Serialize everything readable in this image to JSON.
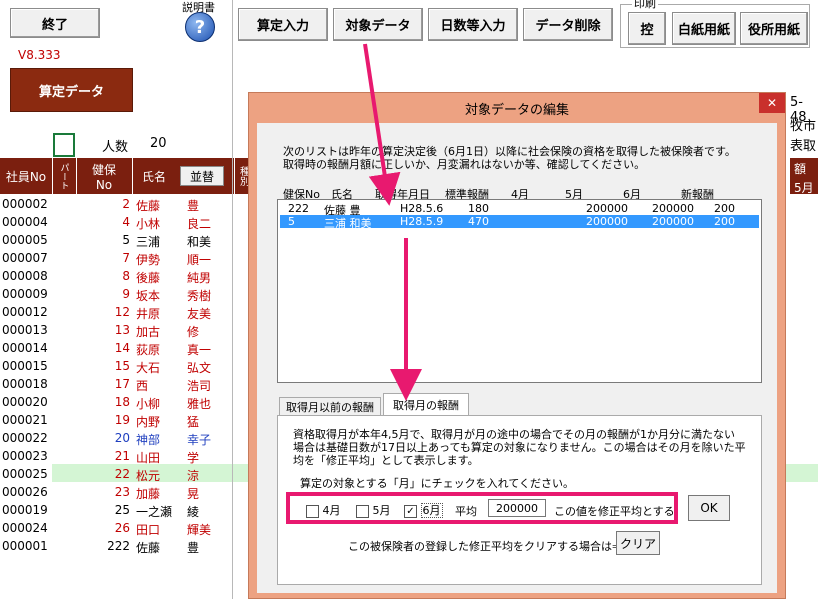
{
  "toolbar": {
    "end_label": "終了",
    "help_label": "説明書",
    "version": "V8.333",
    "santei_data_label": "算定データ",
    "santei_input_label": "算定入力",
    "target_data_label": "対象データ",
    "days_input_label": "日数等入力",
    "delete_label": "データ削除",
    "print_group_label": "印刷",
    "copy_label": "控",
    "blank_paper_label": "白紙用紙",
    "office_paper_label": "役所用紙"
  },
  "right_edge": {
    "text1": "5-48",
    "text2": "牧市",
    "text3": "表取",
    "text4": "額",
    "text5": "5月"
  },
  "list": {
    "headcount_label": "人数",
    "headcount": "20",
    "headers": {
      "emp_no": "社員No",
      "part": "パート",
      "kenpo_no": "健保No",
      "name": "氏名",
      "sort": "並替",
      "extra": "種別"
    },
    "rows": [
      {
        "emp": "000002",
        "no": "2",
        "last": "佐藤",
        "first": "豊",
        "color": "#c00000"
      },
      {
        "emp": "000004",
        "no": "4",
        "last": "小林",
        "first": "良二",
        "color": "#c00000"
      },
      {
        "emp": "000005",
        "no": "5",
        "last": "三浦",
        "first": "和美",
        "color": "#000000"
      },
      {
        "emp": "000007",
        "no": "7",
        "last": "伊勢",
        "first": "順一",
        "color": "#c00000"
      },
      {
        "emp": "000008",
        "no": "8",
        "last": "後藤",
        "first": "純男",
        "color": "#c00000"
      },
      {
        "emp": "000009",
        "no": "9",
        "last": "坂本",
        "first": "秀樹",
        "color": "#c00000"
      },
      {
        "emp": "000012",
        "no": "12",
        "last": "井原",
        "first": "友美",
        "color": "#c00000"
      },
      {
        "emp": "000013",
        "no": "13",
        "last": "加古",
        "first": "修",
        "color": "#c00000"
      },
      {
        "emp": "000014",
        "no": "14",
        "last": "荻原",
        "first": "真一",
        "color": "#c00000"
      },
      {
        "emp": "000015",
        "no": "15",
        "last": "大石",
        "first": "弘文",
        "color": "#c00000"
      },
      {
        "emp": "000018",
        "no": "17",
        "last": "西",
        "first": "浩司",
        "color": "#c00000"
      },
      {
        "emp": "000020",
        "no": "18",
        "last": "小柳",
        "first": "雅也",
        "color": "#c00000"
      },
      {
        "emp": "000021",
        "no": "19",
        "last": "内野",
        "first": "猛",
        "color": "#c00000"
      },
      {
        "emp": "000022",
        "no": "20",
        "last": "神部",
        "first": "幸子",
        "color": "#1f3fbf"
      },
      {
        "emp": "000023",
        "no": "21",
        "last": "山田",
        "first": "学",
        "color": "#c00000"
      },
      {
        "emp": "000025",
        "no": "22",
        "last": "松元",
        "first": "涼",
        "color": "#c00000"
      },
      {
        "emp": "000026",
        "no": "23",
        "last": "加藤",
        "first": "晃",
        "color": "#c00000"
      },
      {
        "emp": "000019",
        "no": "25",
        "last": "一之瀬",
        "first": "綾",
        "color": "#000000"
      },
      {
        "emp": "000024",
        "no": "26",
        "last": "田口",
        "first": "輝美",
        "color": "#c00000"
      },
      {
        "emp": "000001",
        "no": "222",
        "last": "佐藤",
        "first": "豊",
        "color": "#000000"
      }
    ]
  },
  "dialog": {
    "title": "対象データの編集",
    "close_label": "✕",
    "desc1": "次のリストは昨年の算定決定後（6月1日）以降に社会保険の資格を取得した被保険者です。",
    "desc2": "取得時の報酬月額に正しいか、月変漏れはないか等、確認してください。",
    "columns": [
      "健保No",
      "氏名",
      "取得年月日",
      "標準報酬",
      "4月",
      "5月",
      "6月",
      "新報酬"
    ],
    "records": [
      {
        "no": "222",
        "name": "佐藤 豊",
        "date": "H28.5.6",
        "std": "180",
        "m4": "",
        "m5": "200000",
        "m6": "200000",
        "new": "200",
        "selected": false
      },
      {
        "no": "5",
        "name": "三浦 和美",
        "date": "H28.5.9",
        "std": "470",
        "m4": "",
        "m5": "200000",
        "m6": "200000",
        "new": "200",
        "selected": true
      }
    ],
    "tab1": "取得月以前の報酬",
    "tab2": "取得月の報酬",
    "info1": "資格取得月が本年4,5月で、取得月が月の途中の場合でその月の報酬が1か月分に満たない",
    "info2": "場合は基礎日数が17日以上あっても算定の対象になりません。この場合はその月を除いた平",
    "info3": "均を「修正平均」として表示します。",
    "check_instr": "算定の対象とする「月」にチェックを入れてください。",
    "m4_label": "4月",
    "m5_label": "5月",
    "m6_label": "6月",
    "m4_checked": false,
    "m5_checked": false,
    "m6_checked": true,
    "avg_label": "平均",
    "avg_value": "200000",
    "avg_note": "この値を修正平均とする",
    "ok_label": "OK",
    "clear_note": "この被保険者の登録した修正平均をクリアする場合は⇒",
    "clear_label": "クリア"
  },
  "colors": {
    "header_bg": "#7b1f0f",
    "dialog_border": "#e9a07a",
    "highlight": "#e8196f",
    "selected_row": "#3399ff",
    "green_row": "#c6efce"
  }
}
